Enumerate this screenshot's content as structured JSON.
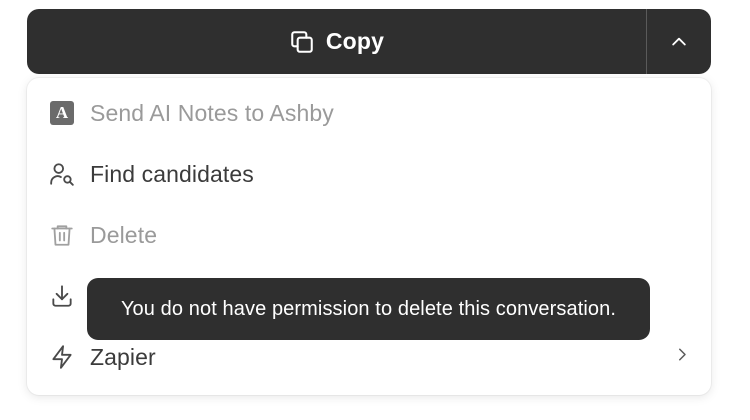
{
  "copy_button": {
    "label": "Copy",
    "icon": "copy-icon",
    "toggle_icon": "chevron-up-icon"
  },
  "menu": {
    "items": [
      {
        "label": "Send AI Notes to Ashby",
        "icon": "ashby-logo-icon",
        "enabled": false
      },
      {
        "label": "Find candidates",
        "icon": "user-search-icon",
        "enabled": true
      },
      {
        "label": "Delete",
        "icon": "trash-icon",
        "enabled": false
      },
      {
        "label": "",
        "icon": "download-icon",
        "enabled": true
      },
      {
        "label": "Zapier",
        "icon": "lightning-icon",
        "enabled": true,
        "submenu": true
      }
    ]
  },
  "ashby_logo_letter": "A",
  "tooltip": {
    "text": "You do not have permission to delete this conversation."
  },
  "colors": {
    "button_bg": "#2f2f2f",
    "text_enabled": "#3b3b3b",
    "text_disabled": "#9a9a9a",
    "tooltip_bg": "#2f2f2f"
  }
}
